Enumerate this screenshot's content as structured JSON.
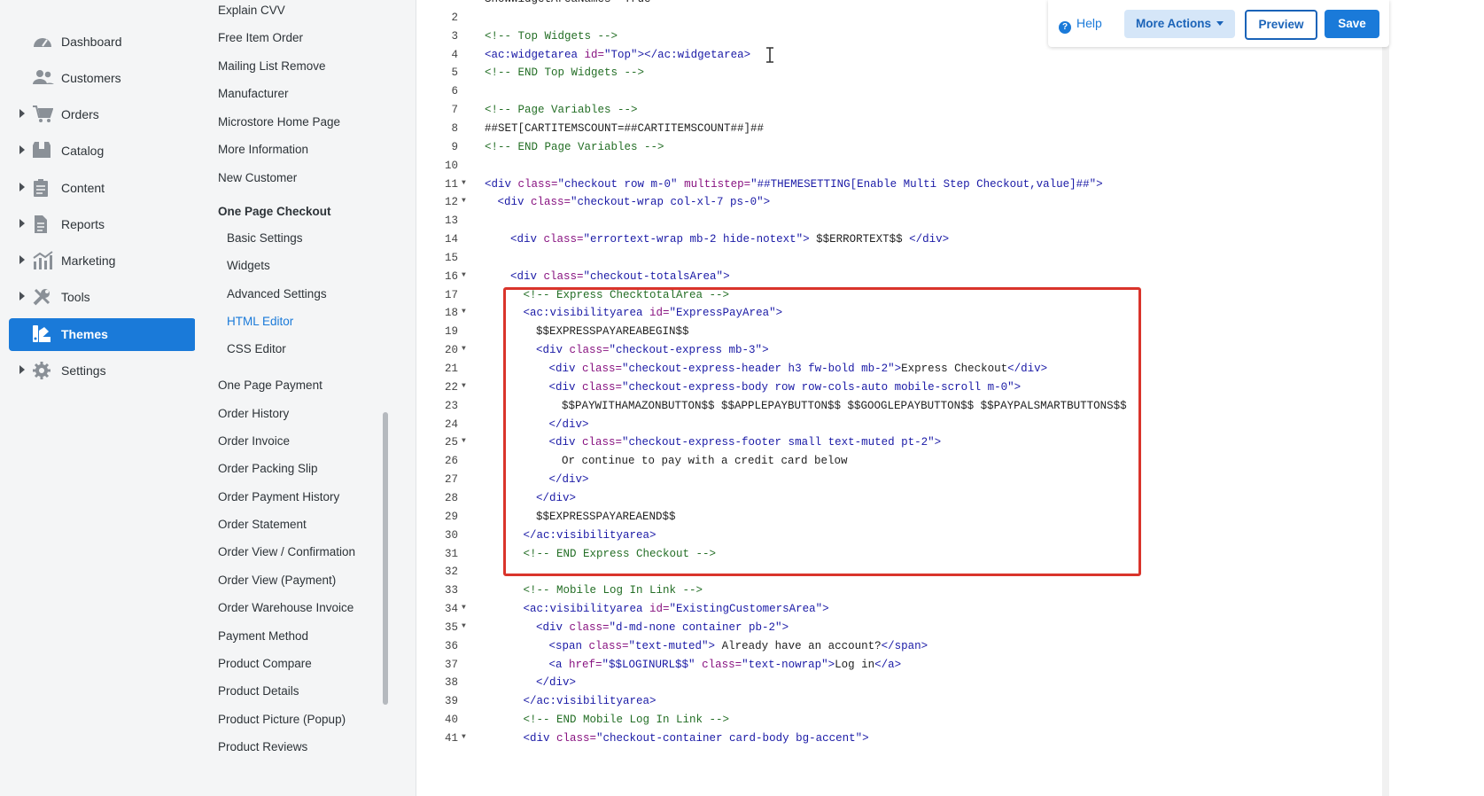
{
  "nav": {
    "items": [
      {
        "label": "Dashboard",
        "icon": "dashboard-gauge-icon",
        "expandable": false,
        "active": false
      },
      {
        "label": "Customers",
        "icon": "customers-people-icon",
        "expandable": false,
        "active": false
      },
      {
        "label": "Orders",
        "icon": "shopping-cart-icon",
        "expandable": true,
        "active": false
      },
      {
        "label": "Catalog",
        "icon": "catalog-box-icon",
        "expandable": true,
        "active": false
      },
      {
        "label": "Content",
        "icon": "content-clipboard-icon",
        "expandable": true,
        "active": false
      },
      {
        "label": "Reports",
        "icon": "reports-document-icon",
        "expandable": true,
        "active": false
      },
      {
        "label": "Marketing",
        "icon": "marketing-chart-icon",
        "expandable": true,
        "active": false
      },
      {
        "label": "Tools",
        "icon": "tools-wrench-icon",
        "expandable": true,
        "active": false
      },
      {
        "label": "Themes",
        "icon": "themes-paint-icon",
        "expandable": false,
        "active": true
      },
      {
        "label": "Settings",
        "icon": "settings-gear-icon",
        "expandable": true,
        "active": false
      }
    ]
  },
  "pages": {
    "items": [
      {
        "label": "Explain CVV",
        "kind": "link"
      },
      {
        "label": "Free Item Order",
        "kind": "link"
      },
      {
        "label": "Mailing List Remove",
        "kind": "link"
      },
      {
        "label": "Manufacturer",
        "kind": "link"
      },
      {
        "label": "Microstore Home Page",
        "kind": "link"
      },
      {
        "label": "More Information",
        "kind": "link"
      },
      {
        "label": "New Customer",
        "kind": "link"
      },
      {
        "label": "One Page Checkout",
        "kind": "group"
      },
      {
        "label": "Basic Settings",
        "kind": "sub"
      },
      {
        "label": "Widgets",
        "kind": "sub"
      },
      {
        "label": "Advanced Settings",
        "kind": "sub"
      },
      {
        "label": "HTML Editor",
        "kind": "sub-selected"
      },
      {
        "label": "CSS Editor",
        "kind": "sub"
      },
      {
        "label": "One Page Payment",
        "kind": "link"
      },
      {
        "label": "Order History",
        "kind": "link"
      },
      {
        "label": "Order Invoice",
        "kind": "link"
      },
      {
        "label": "Order Packing Slip",
        "kind": "link"
      },
      {
        "label": "Order Payment History",
        "kind": "link"
      },
      {
        "label": "Order Statement",
        "kind": "link"
      },
      {
        "label": "Order View / Confirmation",
        "kind": "link"
      },
      {
        "label": "Order View (Payment)",
        "kind": "link"
      },
      {
        "label": "Order Warehouse Invoice",
        "kind": "link"
      },
      {
        "label": "Payment Method",
        "kind": "link"
      },
      {
        "label": "Product Compare",
        "kind": "link"
      },
      {
        "label": "Product Details",
        "kind": "link"
      },
      {
        "label": "Product Picture (Popup)",
        "kind": "link"
      },
      {
        "label": "Product Reviews",
        "kind": "link"
      }
    ]
  },
  "toolbar": {
    "help_label": "Help",
    "more_actions_label": "More Actions",
    "preview_label": "Preview",
    "save_label": "Save"
  },
  "editor": {
    "lines": [
      {
        "n": "",
        "fold": false,
        "indent": 0,
        "tokens": [
          [
            "plain",
            "ShowWidgetAreaNames=\"True\""
          ]
        ]
      },
      {
        "n": "2",
        "fold": false,
        "indent": 0,
        "tokens": []
      },
      {
        "n": "3",
        "fold": false,
        "indent": 0,
        "tokens": [
          [
            "cmt",
            "<!-- Top Widgets -->"
          ]
        ]
      },
      {
        "n": "4",
        "fold": false,
        "indent": 0,
        "tokens": [
          [
            "tag",
            "<ac:widgetarea "
          ],
          [
            "att",
            "id="
          ],
          [
            "str",
            "\"Top\""
          ],
          [
            "tag",
            "></ac:widgetarea>"
          ]
        ]
      },
      {
        "n": "5",
        "fold": false,
        "indent": 0,
        "tokens": [
          [
            "cmt",
            "<!-- END Top Widgets -->"
          ]
        ]
      },
      {
        "n": "6",
        "fold": false,
        "indent": 0,
        "tokens": []
      },
      {
        "n": "7",
        "fold": false,
        "indent": 0,
        "tokens": [
          [
            "cmt",
            "<!-- Page Variables -->"
          ]
        ]
      },
      {
        "n": "8",
        "fold": false,
        "indent": 0,
        "tokens": [
          [
            "plain",
            "##SET[CARTITEMSCOUNT=##CARTITEMSCOUNT##]##"
          ]
        ]
      },
      {
        "n": "9",
        "fold": false,
        "indent": 0,
        "tokens": [
          [
            "cmt",
            "<!-- END Page Variables -->"
          ]
        ]
      },
      {
        "n": "10",
        "fold": false,
        "indent": 0,
        "tokens": []
      },
      {
        "n": "11",
        "fold": true,
        "indent": 0,
        "tokens": [
          [
            "tag",
            "<div "
          ],
          [
            "att",
            "class="
          ],
          [
            "str",
            "\"checkout row m-0\""
          ],
          [
            "att",
            " multistep="
          ],
          [
            "str",
            "\"##THEMESETTING[Enable Multi Step Checkout,value]##\""
          ],
          [
            "tag",
            ">"
          ]
        ]
      },
      {
        "n": "12",
        "fold": true,
        "indent": 1,
        "tokens": [
          [
            "tag",
            "<div "
          ],
          [
            "att",
            "class="
          ],
          [
            "str",
            "\"checkout-wrap col-xl-7 ps-0\""
          ],
          [
            "tag",
            ">"
          ]
        ]
      },
      {
        "n": "13",
        "fold": false,
        "indent": 0,
        "tokens": []
      },
      {
        "n": "14",
        "fold": false,
        "indent": 2,
        "tokens": [
          [
            "tag",
            "<div "
          ],
          [
            "att",
            "class="
          ],
          [
            "str",
            "\"errortext-wrap mb-2 hide-notext\""
          ],
          [
            "tag",
            ">"
          ],
          [
            "plain",
            " $$ERRORTEXT$$ "
          ],
          [
            "tag",
            "</div>"
          ]
        ]
      },
      {
        "n": "15",
        "fold": false,
        "indent": 0,
        "tokens": []
      },
      {
        "n": "16",
        "fold": true,
        "indent": 2,
        "tokens": [
          [
            "tag",
            "<div "
          ],
          [
            "att",
            "class="
          ],
          [
            "str",
            "\"checkout-totalsArea\""
          ],
          [
            "tag",
            ">"
          ]
        ]
      },
      {
        "n": "17",
        "fold": false,
        "indent": 3,
        "tokens": [
          [
            "cmt",
            "<!-- Express ChecktotalArea -->"
          ]
        ]
      },
      {
        "n": "18",
        "fold": true,
        "indent": 3,
        "tokens": [
          [
            "tag",
            "<ac:visibilityarea "
          ],
          [
            "att",
            "id="
          ],
          [
            "str",
            "\"ExpressPayArea\""
          ],
          [
            "tag",
            ">"
          ]
        ]
      },
      {
        "n": "19",
        "fold": false,
        "indent": 4,
        "tokens": [
          [
            "plain",
            "$$EXPRESSPAYAREABEGIN$$"
          ]
        ]
      },
      {
        "n": "20",
        "fold": true,
        "indent": 4,
        "tokens": [
          [
            "tag",
            "<div "
          ],
          [
            "att",
            "class="
          ],
          [
            "str",
            "\"checkout-express mb-3\""
          ],
          [
            "tag",
            ">"
          ]
        ]
      },
      {
        "n": "21",
        "fold": false,
        "indent": 5,
        "tokens": [
          [
            "tag",
            "<div "
          ],
          [
            "att",
            "class="
          ],
          [
            "str",
            "\"checkout-express-header h3 fw-bold mb-2\""
          ],
          [
            "tag",
            ">"
          ],
          [
            "plain",
            "Express Checkout"
          ],
          [
            "tag",
            "</div>"
          ]
        ]
      },
      {
        "n": "22",
        "fold": true,
        "indent": 5,
        "tokens": [
          [
            "tag",
            "<div "
          ],
          [
            "att",
            "class="
          ],
          [
            "str",
            "\"checkout-express-body row row-cols-auto mobile-scroll m-0\""
          ],
          [
            "tag",
            ">"
          ]
        ]
      },
      {
        "n": "23",
        "fold": false,
        "indent": 6,
        "tokens": [
          [
            "plain",
            "$$PAYWITHAMAZONBUTTON$$ $$APPLEPAYBUTTON$$ $$GOOGLEPAYBUTTON$$ $$PAYPALSMARTBUTTONS$$"
          ]
        ]
      },
      {
        "n": "24",
        "fold": false,
        "indent": 5,
        "tokens": [
          [
            "tag",
            "</div>"
          ]
        ]
      },
      {
        "n": "25",
        "fold": true,
        "indent": 5,
        "tokens": [
          [
            "tag",
            "<div "
          ],
          [
            "att",
            "class="
          ],
          [
            "str",
            "\"checkout-express-footer small text-muted pt-2\""
          ],
          [
            "tag",
            ">"
          ]
        ]
      },
      {
        "n": "26",
        "fold": false,
        "indent": 6,
        "tokens": [
          [
            "plain",
            "Or continue to pay with a credit card below"
          ]
        ]
      },
      {
        "n": "27",
        "fold": false,
        "indent": 5,
        "tokens": [
          [
            "tag",
            "</div>"
          ]
        ]
      },
      {
        "n": "28",
        "fold": false,
        "indent": 4,
        "tokens": [
          [
            "tag",
            "</div>"
          ]
        ]
      },
      {
        "n": "29",
        "fold": false,
        "indent": 4,
        "tokens": [
          [
            "plain",
            "$$EXPRESSPAYAREAEND$$"
          ]
        ]
      },
      {
        "n": "30",
        "fold": false,
        "indent": 3,
        "tokens": [
          [
            "tag",
            "</ac:visibilityarea>"
          ]
        ]
      },
      {
        "n": "31",
        "fold": false,
        "indent": 3,
        "tokens": [
          [
            "cmt",
            "<!-- END Express Checkout -->"
          ]
        ]
      },
      {
        "n": "32",
        "fold": false,
        "indent": 0,
        "tokens": []
      },
      {
        "n": "33",
        "fold": false,
        "indent": 3,
        "tokens": [
          [
            "cmt",
            "<!-- Mobile Log In Link -->"
          ]
        ]
      },
      {
        "n": "34",
        "fold": true,
        "indent": 3,
        "tokens": [
          [
            "tag",
            "<ac:visibilityarea "
          ],
          [
            "att",
            "id="
          ],
          [
            "str",
            "\"ExistingCustomersArea\""
          ],
          [
            "tag",
            ">"
          ]
        ]
      },
      {
        "n": "35",
        "fold": true,
        "indent": 4,
        "tokens": [
          [
            "tag",
            "<div "
          ],
          [
            "att",
            "class="
          ],
          [
            "str",
            "\"d-md-none container pb-2\""
          ],
          [
            "tag",
            ">"
          ]
        ]
      },
      {
        "n": "36",
        "fold": false,
        "indent": 5,
        "tokens": [
          [
            "tag",
            "<span "
          ],
          [
            "att",
            "class="
          ],
          [
            "str",
            "\"text-muted\""
          ],
          [
            "tag",
            ">"
          ],
          [
            "plain",
            " Already have an account?"
          ],
          [
            "tag",
            "</span>"
          ]
        ]
      },
      {
        "n": "37",
        "fold": false,
        "indent": 5,
        "tokens": [
          [
            "tag",
            "<a "
          ],
          [
            "att",
            "href="
          ],
          [
            "str",
            "\"$$LOGINURL$$\""
          ],
          [
            "att",
            " class="
          ],
          [
            "str",
            "\"text-nowrap\""
          ],
          [
            "tag",
            ">"
          ],
          [
            "plain",
            "Log in"
          ],
          [
            "tag",
            "</a>"
          ]
        ]
      },
      {
        "n": "38",
        "fold": false,
        "indent": 4,
        "tokens": [
          [
            "tag",
            "</div>"
          ]
        ]
      },
      {
        "n": "39",
        "fold": false,
        "indent": 3,
        "tokens": [
          [
            "tag",
            "</ac:visibilityarea>"
          ]
        ]
      },
      {
        "n": "40",
        "fold": false,
        "indent": 3,
        "tokens": [
          [
            "cmt",
            "<!-- END Mobile Log In Link -->"
          ]
        ]
      },
      {
        "n": "41",
        "fold": true,
        "indent": 3,
        "tokens": [
          [
            "tag",
            "<div "
          ],
          [
            "att",
            "class="
          ],
          [
            "str",
            "\"checkout-container card-body bg-accent\""
          ],
          [
            "tag",
            ">"
          ]
        ]
      }
    ]
  },
  "colors": {
    "accent": "#1a7ad9",
    "highlight": "#d9342b",
    "nav_bg": "#f4f5f6"
  }
}
